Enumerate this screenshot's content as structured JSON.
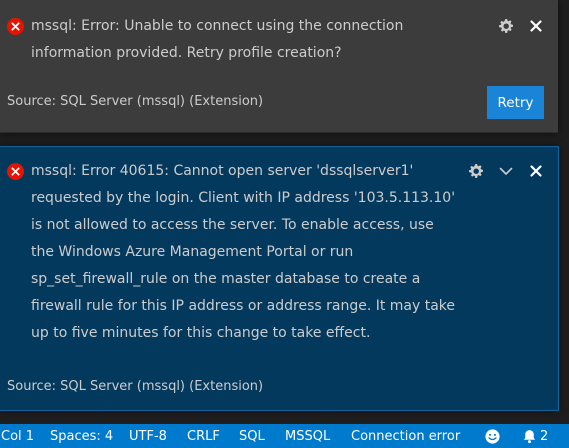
{
  "notification_1": {
    "message": "mssql: Error: Unable to connect using the connection",
    "message_line2": "information provided. Retry profile creation?",
    "source": "Source: SQL Server (mssql) (Extension)",
    "retry_label": "Retry",
    "icons": [
      "error-icon",
      "gear-icon",
      "close-icon"
    ]
  },
  "notification_2": {
    "lines": [
      "mssql: Error 40615: Cannot open server 'dssqlserver1'",
      "requested by the login. Client with IP address '103.5.113.10'",
      "is not allowed to access the server.  To enable access, use",
      "the Windows Azure Management Portal or run",
      "sp_set_firewall_rule on the master database to create a",
      "firewall rule for this IP address or address range.  It may take",
      "up to five minutes for this change to take effect."
    ],
    "source": "Source: SQL Server (mssql) (Extension)",
    "icons": [
      "error-icon",
      "gear-icon",
      "chevron-down-icon",
      "close-icon"
    ]
  },
  "statusbar": {
    "col": "Col 1",
    "spaces": "Spaces: 4",
    "encoding": "UTF-8",
    "eol": "CRLF",
    "language": "SQL",
    "provider": "MSSQL",
    "connection": "Connection error",
    "notifications_count": "2",
    "icons": [
      "smiley-icon",
      "bell-icon"
    ]
  },
  "colors": {
    "toast_bg": "#3c3c3c",
    "toast_focused_bg": "#04395e",
    "error": "#e51400",
    "button": "#1a85d6",
    "statusbar": "#007acc"
  }
}
